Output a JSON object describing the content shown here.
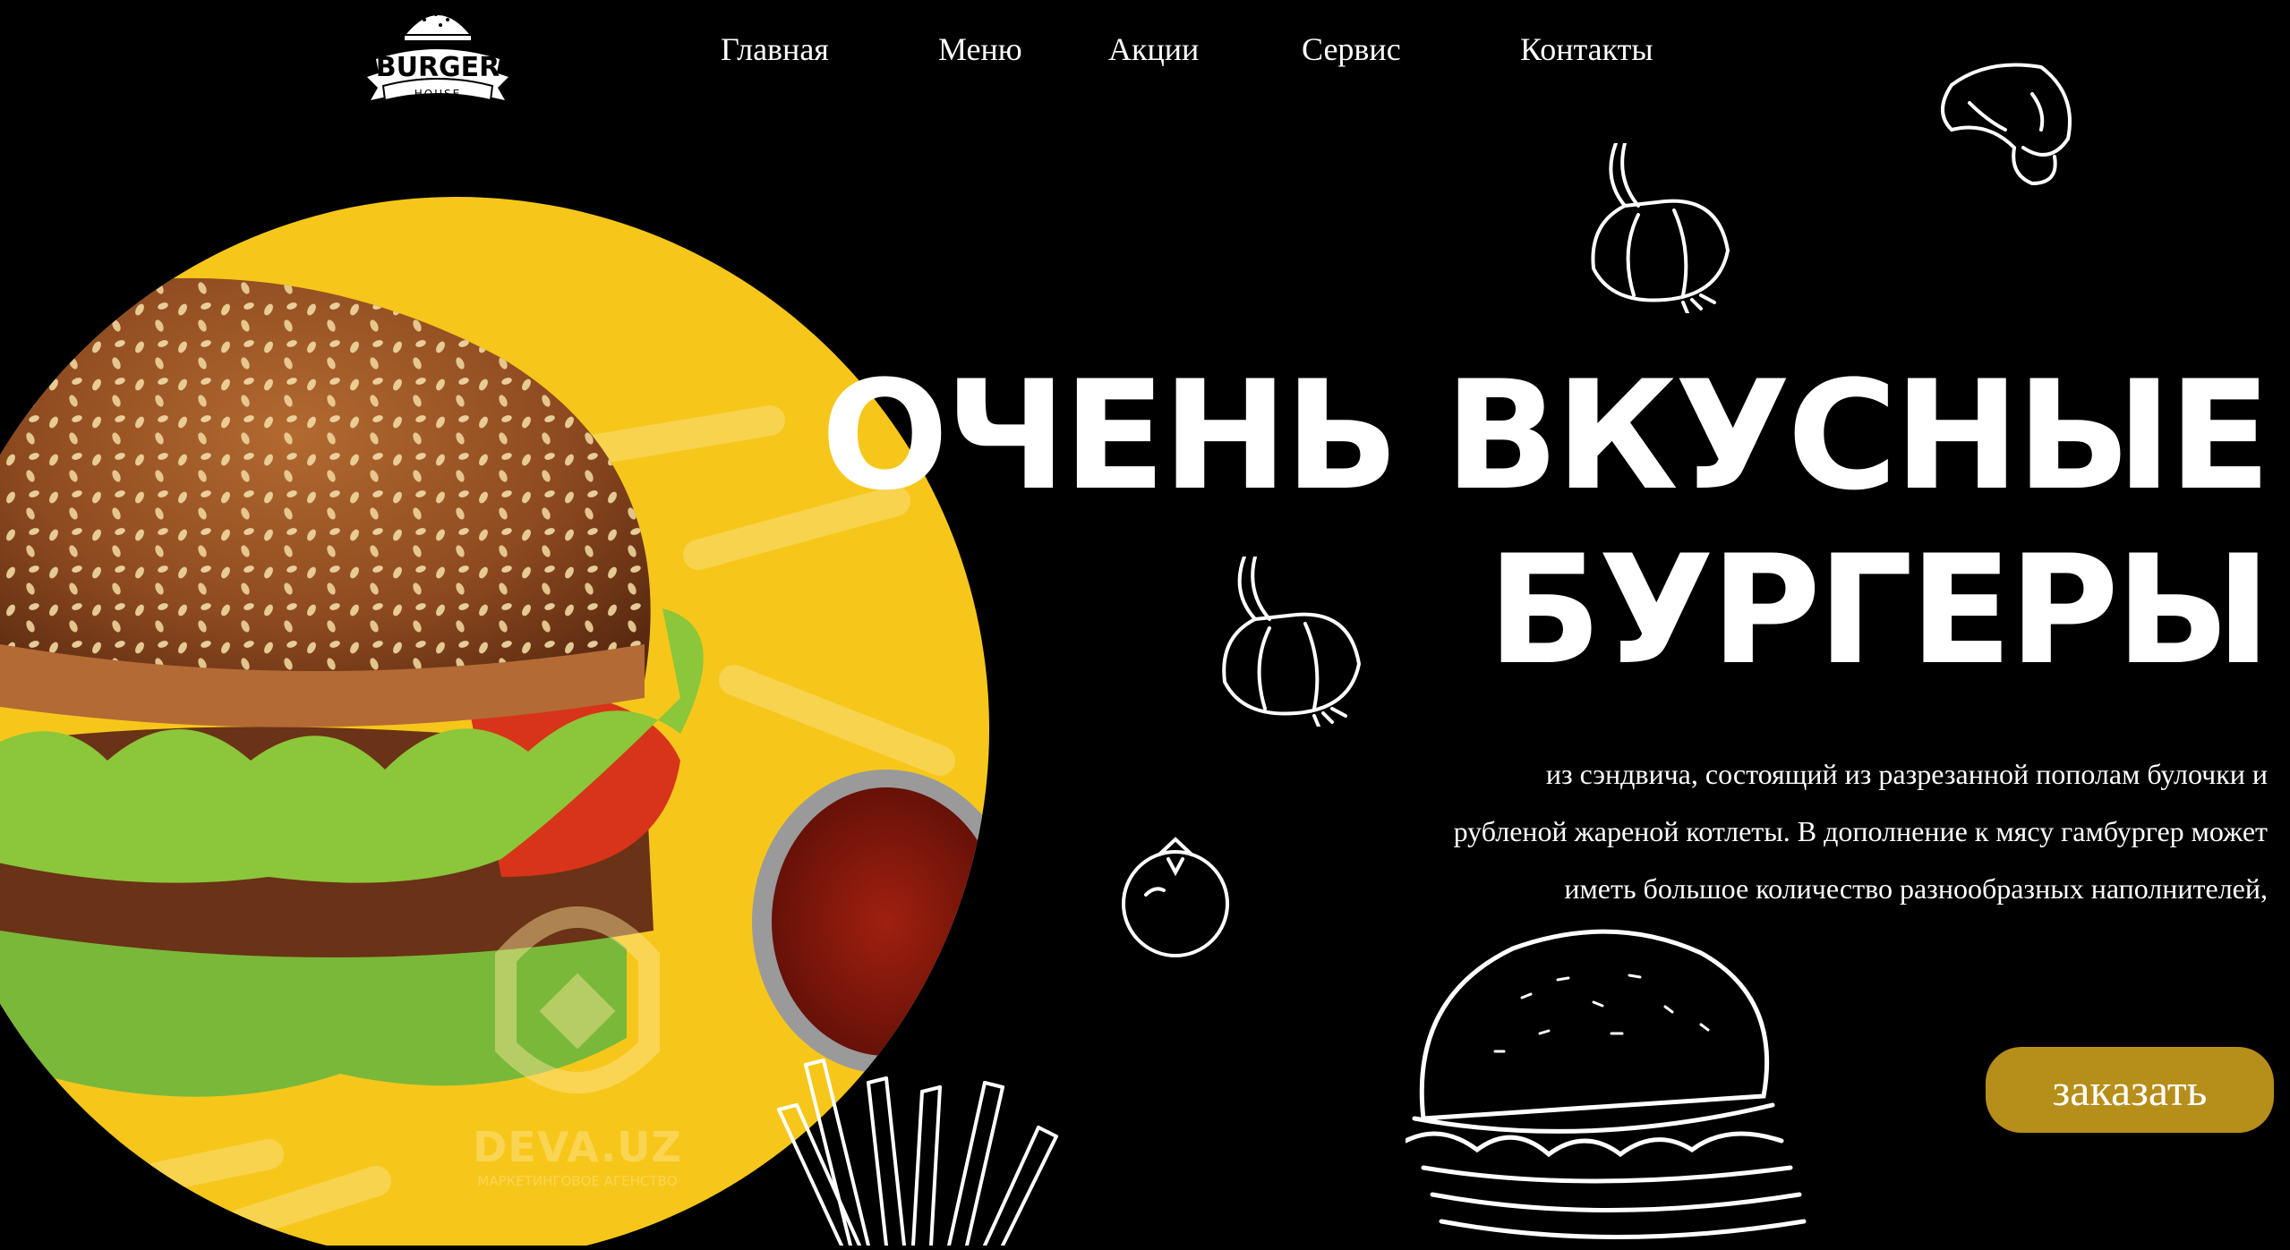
{
  "logo": {
    "top_text": "BURGER",
    "bottom_text": "HOUSE"
  },
  "nav": {
    "items": [
      {
        "label": "Главная"
      },
      {
        "label": "Меню"
      },
      {
        "label": "Акции"
      },
      {
        "label": "Сервис"
      },
      {
        "label": "Контакты"
      }
    ]
  },
  "hero": {
    "title_line1": "ОЧЕНЬ ВКУСНЫЕ",
    "title_line2": "БУРГЕРЫ",
    "description_lines": [
      "из сэндвича, состоящий из разрезанной пополам булочки и",
      "рубленой жареной котлеты. В дополнение к мясу гамбургер может",
      "иметь большое количество разнообразных наполнителей,"
    ],
    "cta_label": "заказать"
  },
  "watermark": {
    "brand": "DEVA.UZ",
    "subtitle": "МАРКЕТИНГОВОЕ АГЕНСТВО"
  },
  "colors": {
    "background": "#000000",
    "accent": "#b68e1a",
    "photo_yellow": "#f6c71a",
    "bun": "#8e4a20",
    "lettuce": "#8cc63a"
  }
}
